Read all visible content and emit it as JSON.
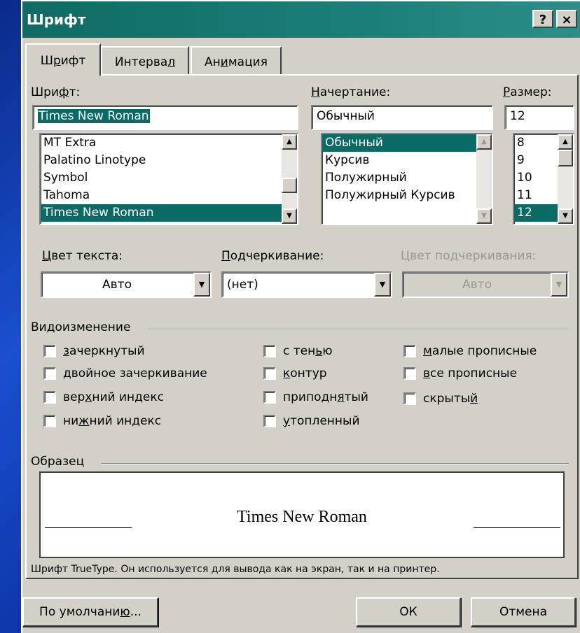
{
  "title": "Шрифт",
  "title_buttons": {
    "help": "?",
    "close": "×"
  },
  "tabs": [
    {
      "pre": "Ш",
      "u": "р",
      "post": "ифт"
    },
    {
      "pre": "Интерва",
      "u": "л",
      "post": ""
    },
    {
      "pre": "Ан",
      "u": "и",
      "post": "мация"
    }
  ],
  "font": {
    "label_pre": "Шри",
    "label_u": "ф",
    "label_post": "т:",
    "value": "Times New Roman",
    "items": [
      "MT Extra",
      "Palatino Linotype",
      "Symbol",
      "Tahoma",
      "Times New Roman"
    ],
    "selected_index": 4
  },
  "style": {
    "label_pre": "",
    "label_u": "Н",
    "label_post": "ачертание:",
    "value": "Обычный",
    "items": [
      "Обычный",
      "Курсив",
      "Полужирный",
      "Полужирный Курсив"
    ],
    "selected_index": 0
  },
  "size": {
    "label_pre": "",
    "label_u": "Р",
    "label_post": "азмер:",
    "value": "12",
    "items": [
      "8",
      "9",
      "10",
      "11",
      "12"
    ],
    "selected_index": 4
  },
  "text_color": {
    "label_pre": "",
    "label_u": "Ц",
    "label_post": "вет текста:",
    "value": "Авто"
  },
  "underline": {
    "label_pre": "",
    "label_u": "П",
    "label_post": "одчеркивание:",
    "value": "(нет)"
  },
  "underline_color": {
    "label": "Цвет подчеркивания:",
    "value": "Авто"
  },
  "effects": {
    "title": "Видоизменение",
    "items": [
      {
        "pre": "",
        "u": "з",
        "post": "ачеркнутый"
      },
      {
        "pre": "",
        "u": "д",
        "post": "войное зачеркивание"
      },
      {
        "pre": "вер",
        "u": "х",
        "post": "ний индекс"
      },
      {
        "pre": "ни",
        "u": "ж",
        "post": "ний индекс"
      },
      {
        "pre": "с тен",
        "u": "ь",
        "post": "ю"
      },
      {
        "pre": "",
        "u": "к",
        "post": "онтур"
      },
      {
        "pre": "приподн",
        "u": "я",
        "post": "тый"
      },
      {
        "pre": "",
        "u": "у",
        "post": "топленный"
      },
      {
        "pre": "",
        "u": "м",
        "post": "алые прописные"
      },
      {
        "pre": "",
        "u": "в",
        "post": "се прописные"
      },
      {
        "pre": "скрыты",
        "u": "й",
        "post": ""
      }
    ]
  },
  "sample": {
    "title": "Образец",
    "text": "Times New Roman",
    "note": "Шрифт TrueType. Он используется для вывода как на экран, так и на принтер."
  },
  "buttons": {
    "default_pre": "По умолчани",
    "default_u": "ю",
    "default_post": "...",
    "ok": "ОК",
    "cancel": "Отмена"
  }
}
